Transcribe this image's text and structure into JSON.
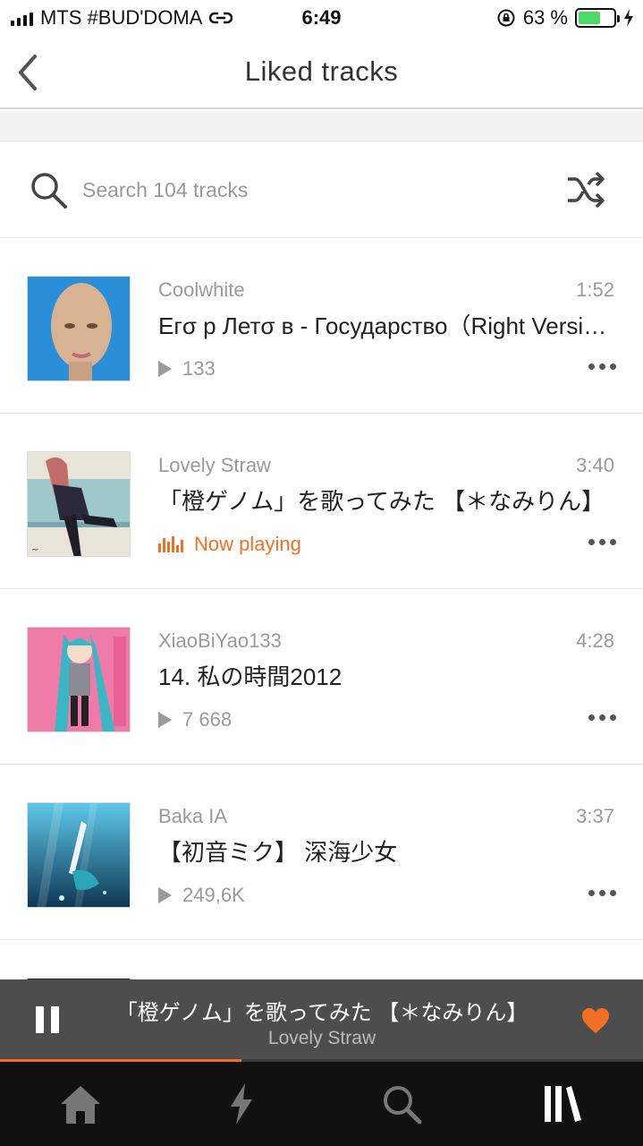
{
  "status_bar": {
    "carrier": "MTS #BUD'DOMA",
    "time": "6:49",
    "battery_text": "63 %",
    "battery_level": 0.63
  },
  "header": {
    "title": "Liked tracks",
    "back_icon": "chevron-left-icon"
  },
  "search": {
    "placeholder": "Search 104 tracks",
    "icons": [
      "search-icon",
      "shuffle-icon"
    ]
  },
  "tracks": [
    {
      "artist": "Coolwhite",
      "duration": "1:52",
      "title": "Егσ р Летσ в - Государство（Right Version）",
      "plays": "133",
      "art_colors": [
        "#2a8fd8",
        "#d7b392"
      ]
    },
    {
      "artist": "Lovely Straw",
      "duration": "3:40",
      "title": "「橙ゲノム」を歌ってみた 【＊なみりん】",
      "status": "Now playing",
      "art_colors": [
        "#9fc8cc",
        "#2a2a3a"
      ]
    },
    {
      "artist": "XiaoBiYao133",
      "duration": "4:28",
      "title": "14. 私の時間2012",
      "plays": "7 668",
      "art_colors": [
        "#f07aa8",
        "#39b7c4"
      ]
    },
    {
      "artist": "Baka IA",
      "duration": "3:37",
      "title": "【初音ミク】 深海少女",
      "plays": "249,6K",
      "art_colors": [
        "#1c7fb8",
        "#0d3552"
      ]
    }
  ],
  "mini_player": {
    "title": "「橙ゲノム」を歌ってみた 【＊なみりん】",
    "artist": "Lovely Straw",
    "progress": 0.376,
    "accent": "#f26f23"
  },
  "tab_bar": {
    "icons": [
      "home-icon",
      "lightning-icon",
      "search-icon",
      "library-icon"
    ],
    "active": "library-icon"
  }
}
